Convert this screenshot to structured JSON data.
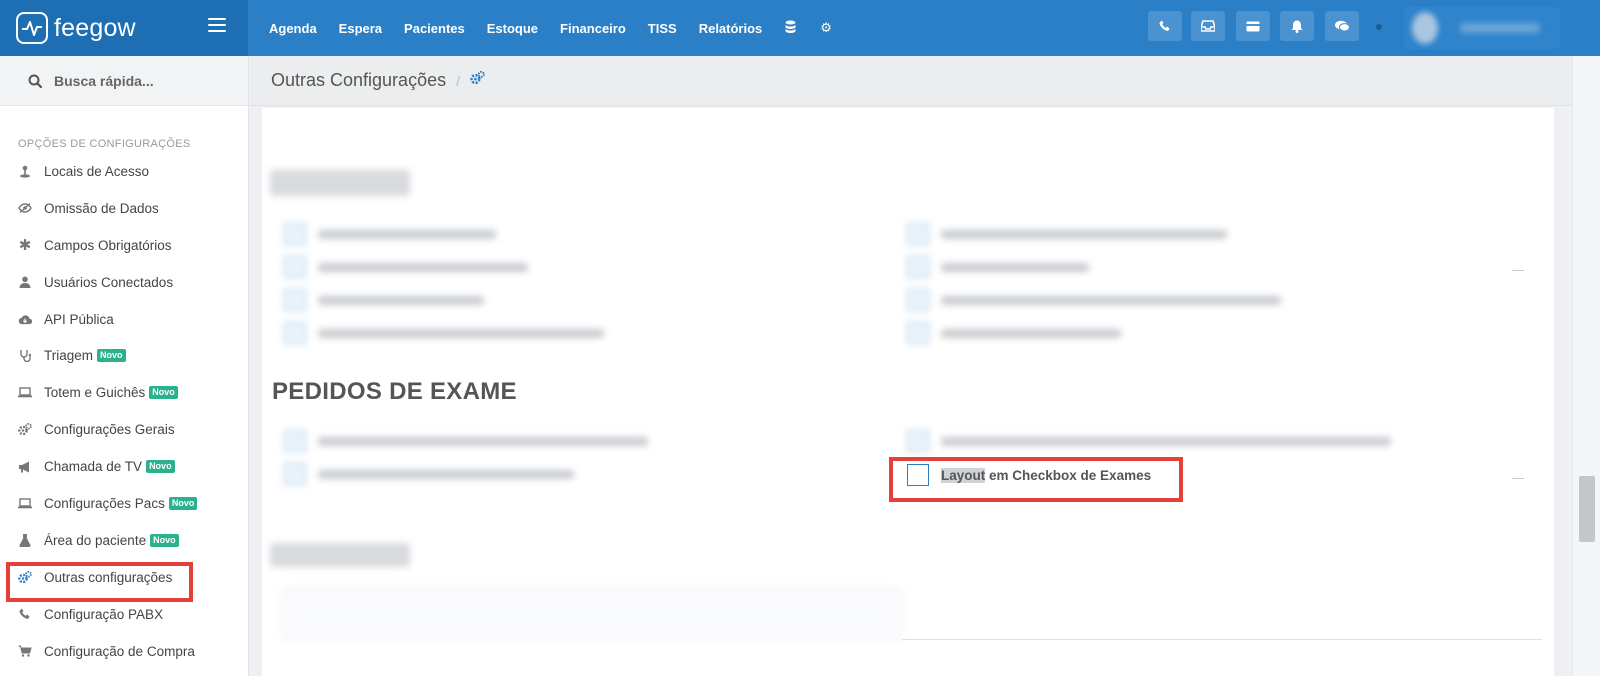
{
  "brand": {
    "name": "feegow"
  },
  "nav": {
    "items": [
      "Agenda",
      "Espera",
      "Pacientes",
      "Estoque",
      "Financeiro",
      "TISS",
      "Relatórios"
    ],
    "icons": [
      "database-icon",
      "gear-icon"
    ]
  },
  "toolbar": {
    "buttons": [
      "phone-icon",
      "inbox-icon",
      "card-icon",
      "bell-icon",
      "chat-icon"
    ]
  },
  "search": {
    "placeholder": "Busca rápida..."
  },
  "sidebar": {
    "title": "OPÇÕES DE CONFIGURAÇÕES",
    "items": [
      {
        "label": "Locais de Acesso",
        "icon": "location-icon",
        "badge": ""
      },
      {
        "label": "Omissão de Dados",
        "icon": "eye-slash-icon",
        "badge": ""
      },
      {
        "label": "Campos Obrigatórios",
        "icon": "asterisk-icon",
        "badge": ""
      },
      {
        "label": "Usuários Conectados",
        "icon": "user-icon",
        "badge": ""
      },
      {
        "label": "API Pública",
        "icon": "cloud-icon",
        "badge": ""
      },
      {
        "label": "Triagem",
        "icon": "stethoscope-icon",
        "badge": "Novo"
      },
      {
        "label": "Totem e Guichês",
        "icon": "laptop-icon",
        "badge": "Novo"
      },
      {
        "label": "Configurações Gerais",
        "icon": "cogs-icon",
        "badge": ""
      },
      {
        "label": "Chamada de TV",
        "icon": "megaphone-icon",
        "badge": "Novo"
      },
      {
        "label": "Configurações Pacs",
        "icon": "laptop-icon",
        "badge": "Novo"
      },
      {
        "label": "Área do paciente",
        "icon": "flask-icon",
        "badge": "Novo"
      },
      {
        "label": "Outras configurações",
        "icon": "cogs-icon",
        "badge": ""
      },
      {
        "label": "Configuração PABX",
        "icon": "phone-icon",
        "badge": ""
      },
      {
        "label": "Configuração de Compra",
        "icon": "cart-icon",
        "badge": ""
      }
    ]
  },
  "header": {
    "title": "Outras Configurações",
    "separator": "/"
  },
  "sections": {
    "pedidos": {
      "title": "PEDIDOS DE EXAME"
    }
  },
  "options": {
    "layout_checkbox": {
      "label_highlight": "Layout",
      "label_rest": " em Checkbox de Exames",
      "checked": false
    }
  },
  "colors": {
    "topbar": "#2a7fc6",
    "brand": "#1d6eb3",
    "badge": "#2bb18d",
    "annotation": "#e3403a"
  }
}
